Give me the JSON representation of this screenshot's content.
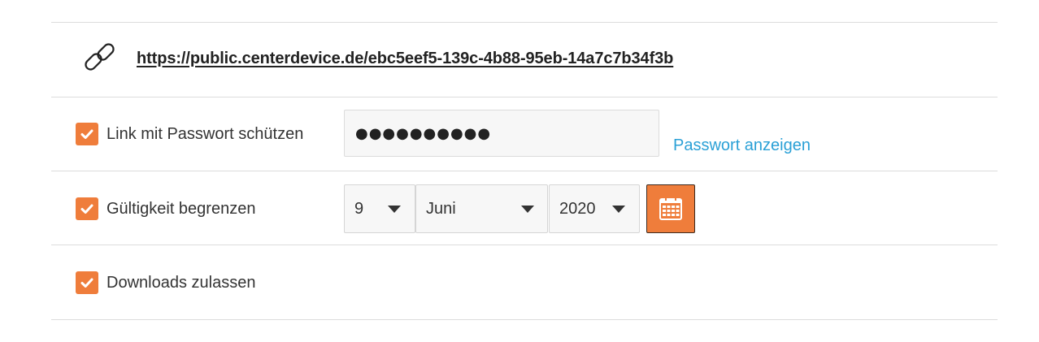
{
  "share": {
    "url": "https://public.centerdevice.de/ebc5eef5-139c-4b88-95eb-14a7c7b34f3b"
  },
  "options": {
    "password": {
      "label": "Link mit Passwort schützen",
      "checked": true,
      "masked_value": "●●●●●●●●●●",
      "show_link": "Passwort anzeigen"
    },
    "expiry": {
      "label": "Gültigkeit begrenzen",
      "checked": true,
      "day": "9",
      "month": "Juni",
      "year": "2020"
    },
    "downloads": {
      "label": "Downloads zulassen",
      "checked": true
    }
  },
  "icons": {
    "link": "link-icon",
    "check": "checkmark-icon",
    "calendar": "calendar-icon",
    "caret": "chevron-down-icon"
  },
  "colors": {
    "accent": "#ef7d3b",
    "link": "#2aa0d6",
    "divider": "#dcdcdc",
    "input_bg": "#f7f7f7"
  }
}
